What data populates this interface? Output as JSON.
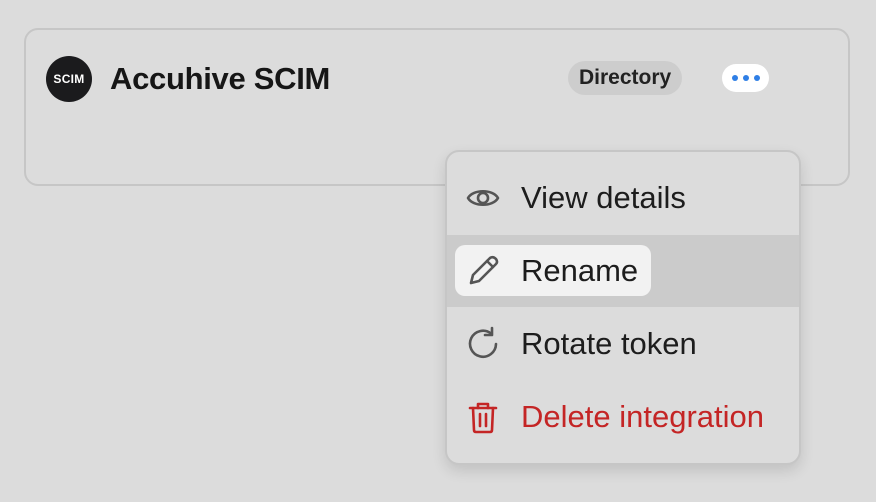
{
  "integration": {
    "logo_text": "SCIM",
    "name": "Accuhive SCIM",
    "badge": "Directory"
  },
  "menu": {
    "items": [
      {
        "label": "View details",
        "icon": "eye-icon"
      },
      {
        "label": "Rename",
        "icon": "pencil-icon"
      },
      {
        "label": "Rotate token",
        "icon": "refresh-icon"
      },
      {
        "label": "Delete integration",
        "icon": "trash-icon"
      }
    ]
  },
  "colors": {
    "accent": "#2f7fe6",
    "danger": "#c42525",
    "background": "#dcdcdc",
    "hover": "#cbcbcb"
  }
}
